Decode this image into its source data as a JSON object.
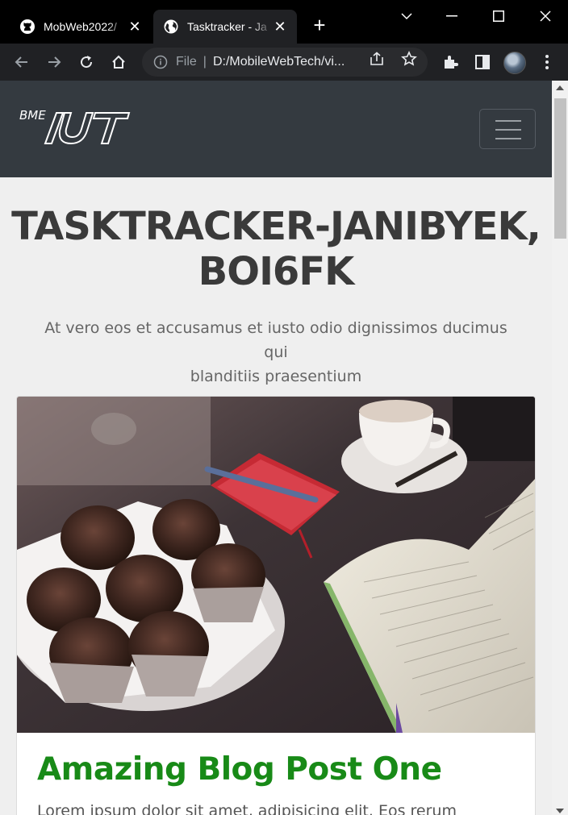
{
  "browser": {
    "tabs": [
      {
        "title": "MobWeb2022/",
        "icon": "github-icon"
      },
      {
        "title": "Tasktracker - Ja",
        "icon": "globe-icon",
        "active": true
      }
    ],
    "omnibox": {
      "scheme": "File",
      "url": "D:/MobileWebTech/vi..."
    }
  },
  "site": {
    "logo_text": "BME"
  },
  "hero": {
    "title_line1": "TASKTRACKER-JANIBYEK,",
    "title_line2": "BOI6FK",
    "subtitle_line1": "At vero eos et accusamus et iusto odio dignissimos ducimus qui",
    "subtitle_line2": "blanditiis praesentium"
  },
  "post": {
    "title": "Amazing Blog Post One",
    "excerpt": "Lorem ipsum dolor sit amet, adipisicing elit. Eos rerum"
  },
  "colors": {
    "accent_green": "#188a17",
    "navbar": "#343a40",
    "page_bg": "#efefef"
  }
}
